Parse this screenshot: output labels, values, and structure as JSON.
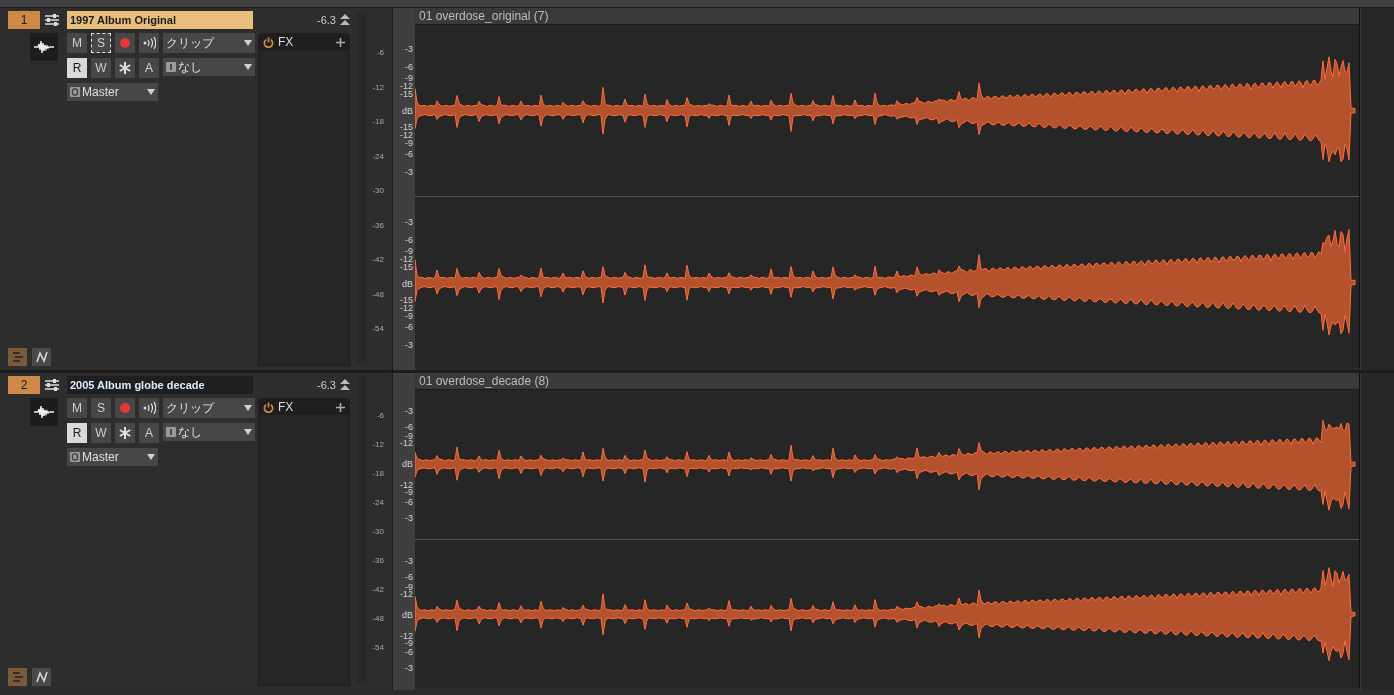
{
  "tracks": [
    {
      "number": "1",
      "name": "1997 Album Original",
      "selected": true,
      "volume": "-6.3",
      "mute": {
        "label": "M",
        "on": false
      },
      "solo": {
        "label": "S",
        "on": false,
        "focused": true
      },
      "read": {
        "label": "R",
        "on": true
      },
      "write": {
        "label": "W",
        "on": false
      },
      "auto": {
        "label": "A"
      },
      "input": "クリップ",
      "midi": "なし",
      "output": "Master",
      "fx": "FX",
      "meter_scale": [
        "-6",
        "-12",
        "-18",
        "-24",
        "-30",
        "-36",
        "-42",
        "-48",
        "-54"
      ],
      "clip": {
        "title": "01 overdose_original (7)",
        "channels": [
          {
            "scale": [
              "-3",
              "-6",
              "-9",
              "-12",
              "-15",
              "dB",
              "-15",
              "-12",
              "-9",
              "-6",
              "-3"
            ]
          },
          {
            "scale": [
              "-3",
              "-6",
              "-9",
              "-12",
              "-15",
              "dB",
              "-15",
              "-12",
              "-9",
              "-6",
              "-3"
            ]
          }
        ]
      }
    },
    {
      "number": "2",
      "name": "2005 Album globe decade",
      "selected": false,
      "volume": "-6.3",
      "mute": {
        "label": "M",
        "on": false
      },
      "solo": {
        "label": "S",
        "on": false,
        "focused": false
      },
      "read": {
        "label": "R",
        "on": true
      },
      "write": {
        "label": "W",
        "on": false
      },
      "auto": {
        "label": "A"
      },
      "input": "クリップ",
      "midi": "なし",
      "output": "Master",
      "fx": "FX",
      "meter_scale": [
        "-6",
        "-12",
        "-18",
        "-24",
        "-30",
        "-36",
        "-42",
        "-48",
        "-54"
      ],
      "clip": {
        "title": "01 overdose_decade (8)",
        "channels": [
          {
            "scale": [
              "-3",
              "-6",
              "-9",
              "-12",
              "dB",
              "-12",
              "-9",
              "-6",
              "-3"
            ]
          },
          {
            "scale": [
              "-3",
              "-6",
              "-9",
              "-12",
              "dB",
              "-12",
              "-9",
              "-6",
              "-3"
            ]
          }
        ]
      }
    }
  ]
}
